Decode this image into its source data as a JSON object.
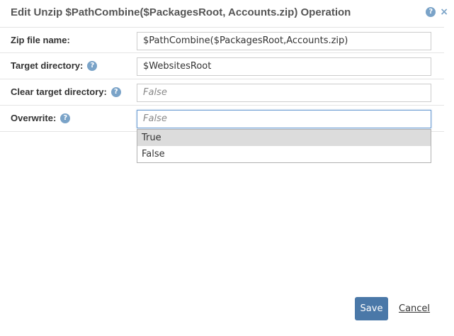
{
  "dialog": {
    "title": "Edit Unzip $PathCombine($PackagesRoot, Accounts.zip) Operation",
    "help_icon": "?",
    "close_icon": "×"
  },
  "form": {
    "zip_file_name": {
      "label": "Zip file name:",
      "value": "$PathCombine($PackagesRoot,Accounts.zip)"
    },
    "target_directory": {
      "label": "Target directory:",
      "help_icon": "?",
      "value": "$WebsitesRoot"
    },
    "clear_target_directory": {
      "label": "Clear target directory:",
      "help_icon": "?",
      "placeholder": "False"
    },
    "overwrite": {
      "label": "Overwrite:",
      "help_icon": "?",
      "placeholder": "False",
      "options": [
        "True",
        "False"
      ],
      "highlighted_option": "True"
    }
  },
  "actions": {
    "save_label": "Save",
    "cancel_label": "Cancel"
  },
  "colors": {
    "accent": "#4a78a8",
    "help_icon": "#7aa3c8",
    "focus_border": "#6d9cd2",
    "option_highlight": "#dcdcdc"
  }
}
